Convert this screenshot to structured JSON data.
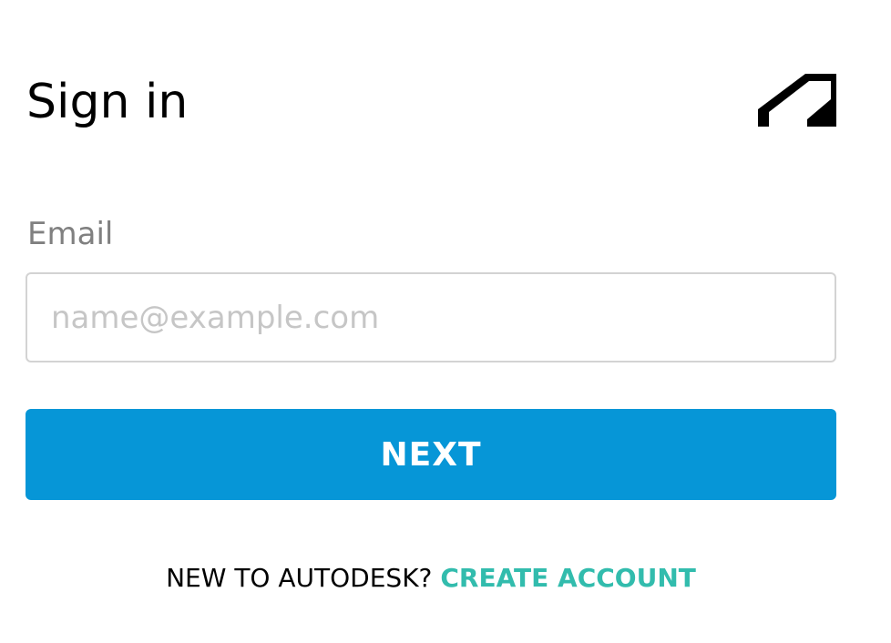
{
  "header": {
    "title": "Sign in",
    "logo_icon": "autodesk-logo-icon"
  },
  "form": {
    "email_label": "Email",
    "email_value": "",
    "email_placeholder": "name@example.com",
    "next_label": "NEXT"
  },
  "footer": {
    "prompt": "NEW TO AUTODESK?",
    "create_account_label": "CREATE ACCOUNT"
  },
  "colors": {
    "primary_button": "#0696d7",
    "link": "#32bcad",
    "label": "#808080",
    "placeholder": "#c6c6c6",
    "input_border": "#d3d3d3"
  }
}
